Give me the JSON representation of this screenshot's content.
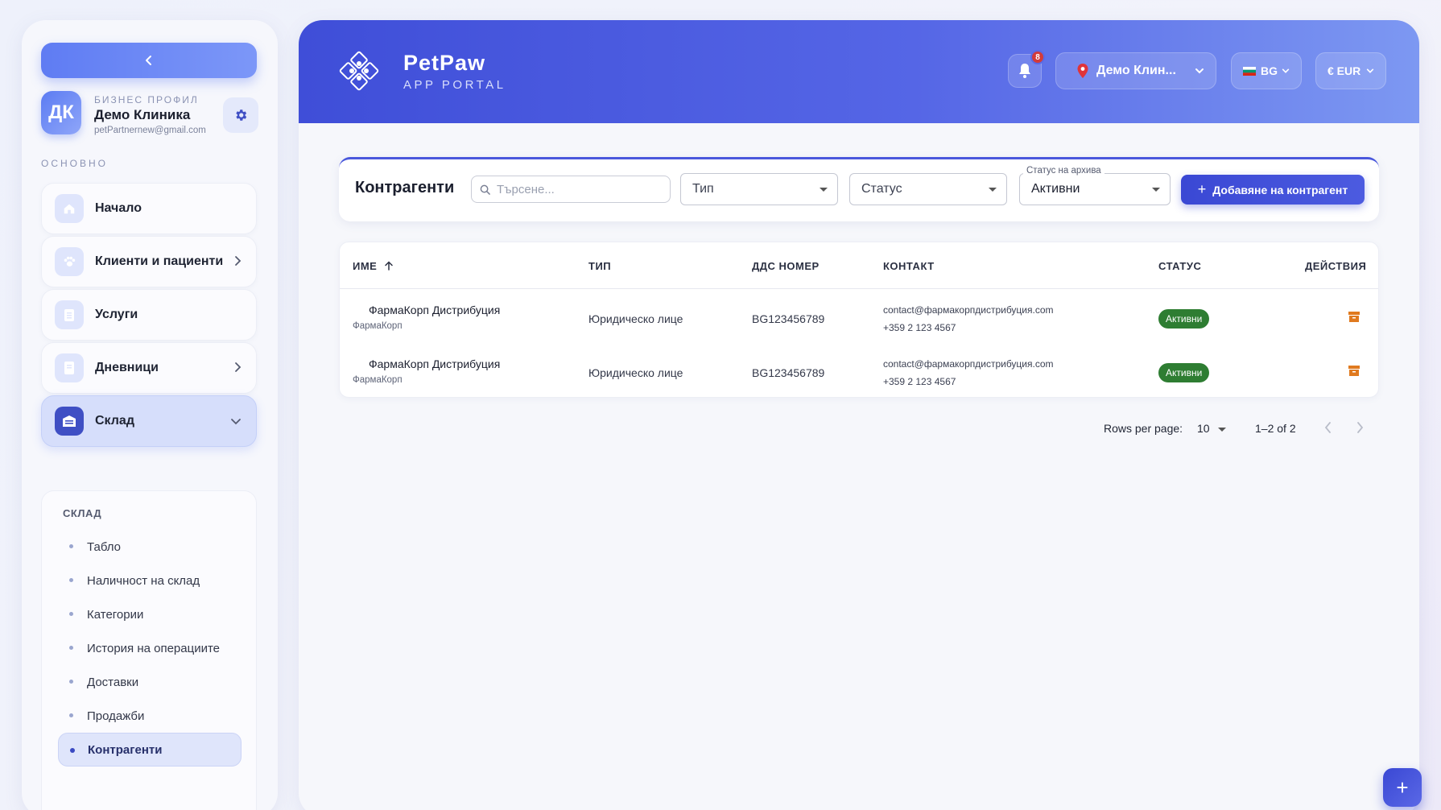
{
  "sidebar": {
    "profile": {
      "initials": "ДК",
      "kicker": "БИЗНЕС ПРОФИЛ",
      "name": "Демо Клиника",
      "email": "petPartnernew@gmail.com"
    },
    "section_label": "ОСНОВНО",
    "items": [
      {
        "label": "Начало",
        "icon": "home-icon",
        "has_chevron": false
      },
      {
        "label": "Клиенти и пациенти",
        "icon": "paw-icon",
        "has_chevron": true
      },
      {
        "label": "Услуги",
        "icon": "clipboard-icon",
        "has_chevron": false
      },
      {
        "label": "Дневници",
        "icon": "journal-icon",
        "has_chevron": true
      },
      {
        "label": "Склад",
        "icon": "warehouse-icon",
        "has_chevron": true,
        "expanded": true
      }
    ],
    "submenu": {
      "title": "СКЛАД",
      "items": [
        {
          "label": "Табло"
        },
        {
          "label": "Наличност на склад"
        },
        {
          "label": "Категории"
        },
        {
          "label": "История на операциите"
        },
        {
          "label": "Доставки"
        },
        {
          "label": "Продажби"
        },
        {
          "label": "Контрагенти",
          "active": true
        }
      ]
    }
  },
  "header": {
    "brand_name": "PetPaw",
    "brand_sub": "APP PORTAL",
    "notifications_count": "8",
    "location": "Демо Клин...",
    "language": "BG",
    "currency": "€ EUR"
  },
  "toolbar": {
    "title": "Контрагенти",
    "search_placeholder": "Търсене...",
    "type_select": "Тип",
    "status_select": "Статус",
    "archive_label": "Статус на архива",
    "archive_value": "Активни",
    "add_button": "Добавяне на контрагент"
  },
  "table": {
    "columns": [
      "ИМЕ",
      "ТИП",
      "ДДС НОМЕР",
      "КОНТАКТ",
      "СТАТУС",
      "ДЕЙСТВИЯ"
    ],
    "rows": [
      {
        "name": "ФармаКорп Дистрибуция",
        "short": "ФармаКорп",
        "type": "Юридическо лице",
        "vat": "BG123456789",
        "email": "contact@фармакорпдистрибуция.com",
        "phone": "+359 2 123 4567",
        "status": "Активни"
      },
      {
        "name": "ФармаКорп Дистрибуция",
        "short": "ФармаКорп",
        "type": "Юридическо лице",
        "vat": "BG123456789",
        "email": "contact@фармакорпдистрибуция.com",
        "phone": "+359 2 123 4567",
        "status": "Активни"
      }
    ]
  },
  "pagination": {
    "rows_label": "Rows per page:",
    "rows_value": "10",
    "range": "1–2 of 2"
  },
  "colors": {
    "accent": "#3f4ed8",
    "status_active": "#2e7d32",
    "archive_icon": "#e07a1f"
  }
}
